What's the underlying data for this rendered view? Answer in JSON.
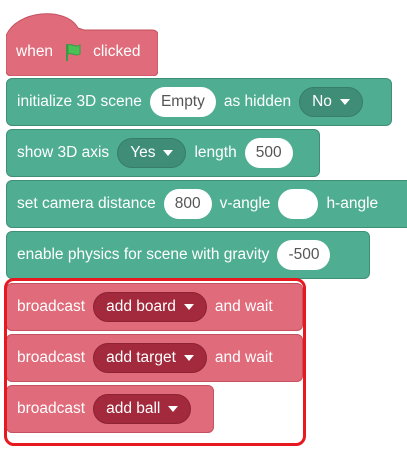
{
  "hat_block": {
    "when_label": "when",
    "flag_icon": "green-flag-icon",
    "clicked_label": "clicked"
  },
  "blocks": {
    "init_scene": {
      "prefix": "initialize 3D scene",
      "scene_value": "Empty",
      "middle": "as hidden",
      "hidden_value": "No"
    },
    "show_axis": {
      "prefix": "show 3D axis",
      "axis_value": "Yes",
      "middle": "length",
      "length_value": "500"
    },
    "camera": {
      "prefix": "set camera distance",
      "distance_value": "800",
      "vangle_label": "v-angle",
      "vangle_value": "",
      "hangle_label": "h-angle"
    },
    "physics": {
      "prefix": "enable physics for scene with gravity",
      "gravity_value": "-500"
    },
    "broadcast_board": {
      "prefix": "broadcast",
      "message": "add board",
      "suffix": "and wait"
    },
    "broadcast_target": {
      "prefix": "broadcast",
      "message": "add target",
      "suffix": "and wait"
    },
    "broadcast_ball": {
      "prefix": "broadcast",
      "message": "add ball"
    }
  },
  "colors": {
    "extension_block": "#4fae92",
    "event_block": "#e06b7a",
    "event_dropdown": "#a32a3c",
    "highlight": "#e8181f",
    "flag": "#4cbf56"
  }
}
